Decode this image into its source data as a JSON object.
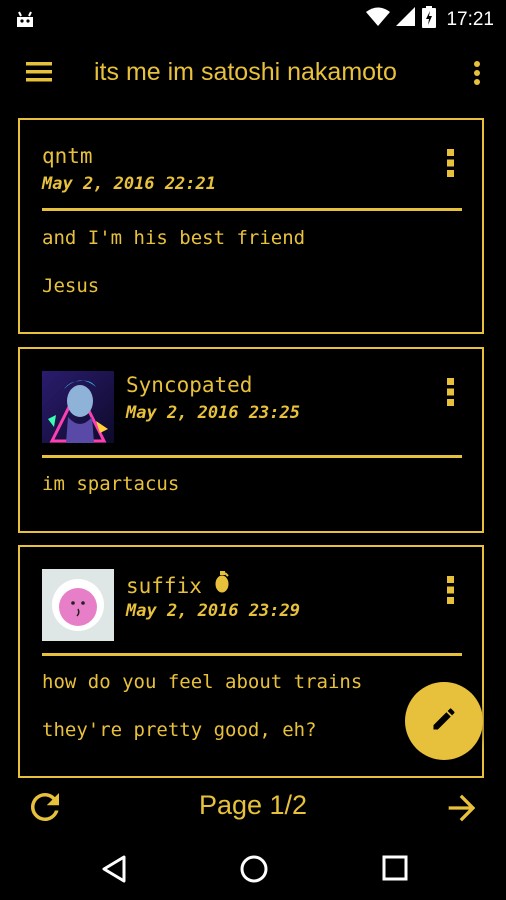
{
  "status_bar": {
    "time": "17:21",
    "icons": [
      "android-icon",
      "wifi-icon",
      "signal-icon",
      "battery-icon"
    ]
  },
  "app_bar": {
    "title": "its me im satoshi nakamoto",
    "icons": [
      "menu-icon",
      "overflow-menu-icon"
    ]
  },
  "posts": [
    {
      "author": "qntm",
      "date": "May 2, 2016 22:21",
      "lines": [
        "and I'm his best friend",
        "Jesus"
      ]
    },
    {
      "author": "Syncopated",
      "date": "May 2, 2016 23:25",
      "lines": [
        "im spartacus"
      ]
    },
    {
      "author": "suffix",
      "author_icon": "grenade-icon",
      "date": "May 2, 2016 23:29",
      "lines": [
        "how do you feel about trains",
        "they're pretty good, eh?"
      ]
    }
  ],
  "fab": {
    "icon": "pencil-icon"
  },
  "pager": {
    "label": "Page 1/2",
    "icons": [
      "refresh-icon",
      "arrow-right-icon"
    ]
  },
  "nav_bar": {
    "icons": [
      "back-icon",
      "home-icon",
      "recents-icon"
    ]
  },
  "colors": {
    "accent": "#e8c13c",
    "background": "#000000"
  }
}
